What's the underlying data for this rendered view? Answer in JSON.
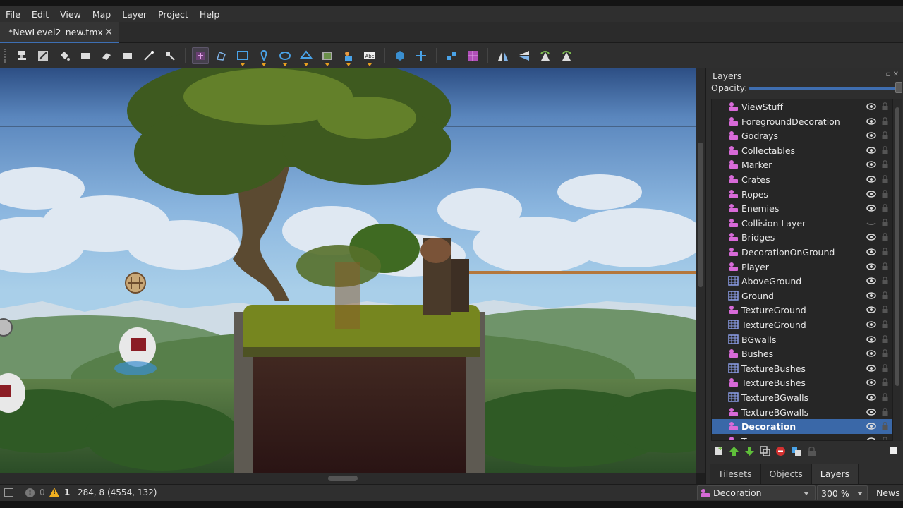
{
  "menu": [
    "File",
    "Edit",
    "View",
    "Map",
    "Layer",
    "Project",
    "Help"
  ],
  "document_tab": {
    "title": "*NewLevel2_new.tmx",
    "close": "✕"
  },
  "toolbar": {
    "tools": [
      {
        "name": "stamp-brush-tool-icon"
      },
      {
        "name": "terrain-brush-tool-icon"
      },
      {
        "name": "bucket-fill-tool-icon"
      },
      {
        "name": "shape-fill-tool-icon"
      },
      {
        "name": "eraser-tool-icon"
      },
      {
        "name": "rectangular-select-tool-icon"
      },
      {
        "name": "magic-wand-tool-icon"
      },
      {
        "name": "select-same-tile-tool-icon"
      },
      {
        "name": "select-objects-tool-icon",
        "active": true
      },
      {
        "name": "edit-polygons-tool-icon"
      },
      {
        "name": "insert-rectangle-tool-icon",
        "dropdown": true
      },
      {
        "name": "insert-point-tool-icon",
        "dropdown": true
      },
      {
        "name": "insert-ellipse-tool-icon",
        "dropdown": true
      },
      {
        "name": "insert-polygon-tool-icon",
        "dropdown": true
      },
      {
        "name": "insert-tile-tool-icon",
        "dropdown": true
      },
      {
        "name": "insert-template-tool-icon",
        "dropdown": true
      },
      {
        "name": "insert-text-tool-icon",
        "dropdown": true
      },
      {
        "name": "world-tool-icon"
      },
      {
        "name": "move-world-tool-icon"
      },
      {
        "name": "random-mode-icon"
      },
      {
        "name": "wang-fill-mode-icon"
      },
      {
        "name": "flip-horizontal-icon"
      },
      {
        "name": "flip-vertical-icon"
      },
      {
        "name": "rotate-left-icon"
      },
      {
        "name": "rotate-right-icon"
      }
    ],
    "text_tool_label": "Abc"
  },
  "layers_panel": {
    "title": "Layers",
    "opacity_label": "Opacity:",
    "opacity_value": 1.0,
    "selected_index": 22,
    "layers": [
      {
        "name": "ViewStuff",
        "type": "object",
        "visible": true
      },
      {
        "name": "ForegroundDecoration",
        "type": "object",
        "visible": true
      },
      {
        "name": "Godrays",
        "type": "object",
        "visible": true
      },
      {
        "name": "Collectables",
        "type": "object",
        "visible": true
      },
      {
        "name": "Marker",
        "type": "object",
        "visible": true
      },
      {
        "name": "Crates",
        "type": "object",
        "visible": true
      },
      {
        "name": "Ropes",
        "type": "object",
        "visible": true
      },
      {
        "name": "Enemies",
        "type": "object",
        "visible": true
      },
      {
        "name": "Collision Layer",
        "type": "object",
        "visible": false
      },
      {
        "name": "Bridges",
        "type": "object",
        "visible": true
      },
      {
        "name": "DecorationOnGround",
        "type": "object",
        "visible": true
      },
      {
        "name": "Player",
        "type": "object",
        "visible": true
      },
      {
        "name": "AboveGround",
        "type": "tile",
        "visible": true
      },
      {
        "name": "Ground",
        "type": "tile",
        "visible": true
      },
      {
        "name": "TextureGround",
        "type": "object",
        "visible": true
      },
      {
        "name": "TextureGround",
        "type": "tile",
        "visible": true
      },
      {
        "name": "BGwalls",
        "type": "tile",
        "visible": true
      },
      {
        "name": "Bushes",
        "type": "object",
        "visible": true
      },
      {
        "name": "TextureBushes",
        "type": "tile",
        "visible": true
      },
      {
        "name": "TextureBushes",
        "type": "object",
        "visible": true
      },
      {
        "name": "TextureBGwalls",
        "type": "tile",
        "visible": true
      },
      {
        "name": "TextureBGwalls",
        "type": "object",
        "visible": true
      },
      {
        "name": "Decoration",
        "type": "object",
        "visible": true
      },
      {
        "name": "Trees",
        "type": "object",
        "visible": true
      }
    ],
    "action_buttons": [
      "new-layer-icon",
      "raise-layer-icon",
      "lower-layer-icon",
      "duplicate-layer-icon",
      "remove-layer-icon",
      "show-hide-other-layers-icon",
      "lock-layer-icon"
    ]
  },
  "dock_tabs": [
    "Tilesets",
    "Objects",
    "Layers"
  ],
  "active_dock_tab": "Layers",
  "statusbar": {
    "info_count": "0",
    "warning_count": "1",
    "coordinates": "284, 8 (4554, 132)",
    "current_layer": "Decoration",
    "zoom": "300 %",
    "news": "News"
  },
  "colors": {
    "accent": "#3a68a8",
    "object_layer_icon": "#d86ad8",
    "tile_layer_icon": "#8c9ee8",
    "warning": "#f0b020"
  }
}
